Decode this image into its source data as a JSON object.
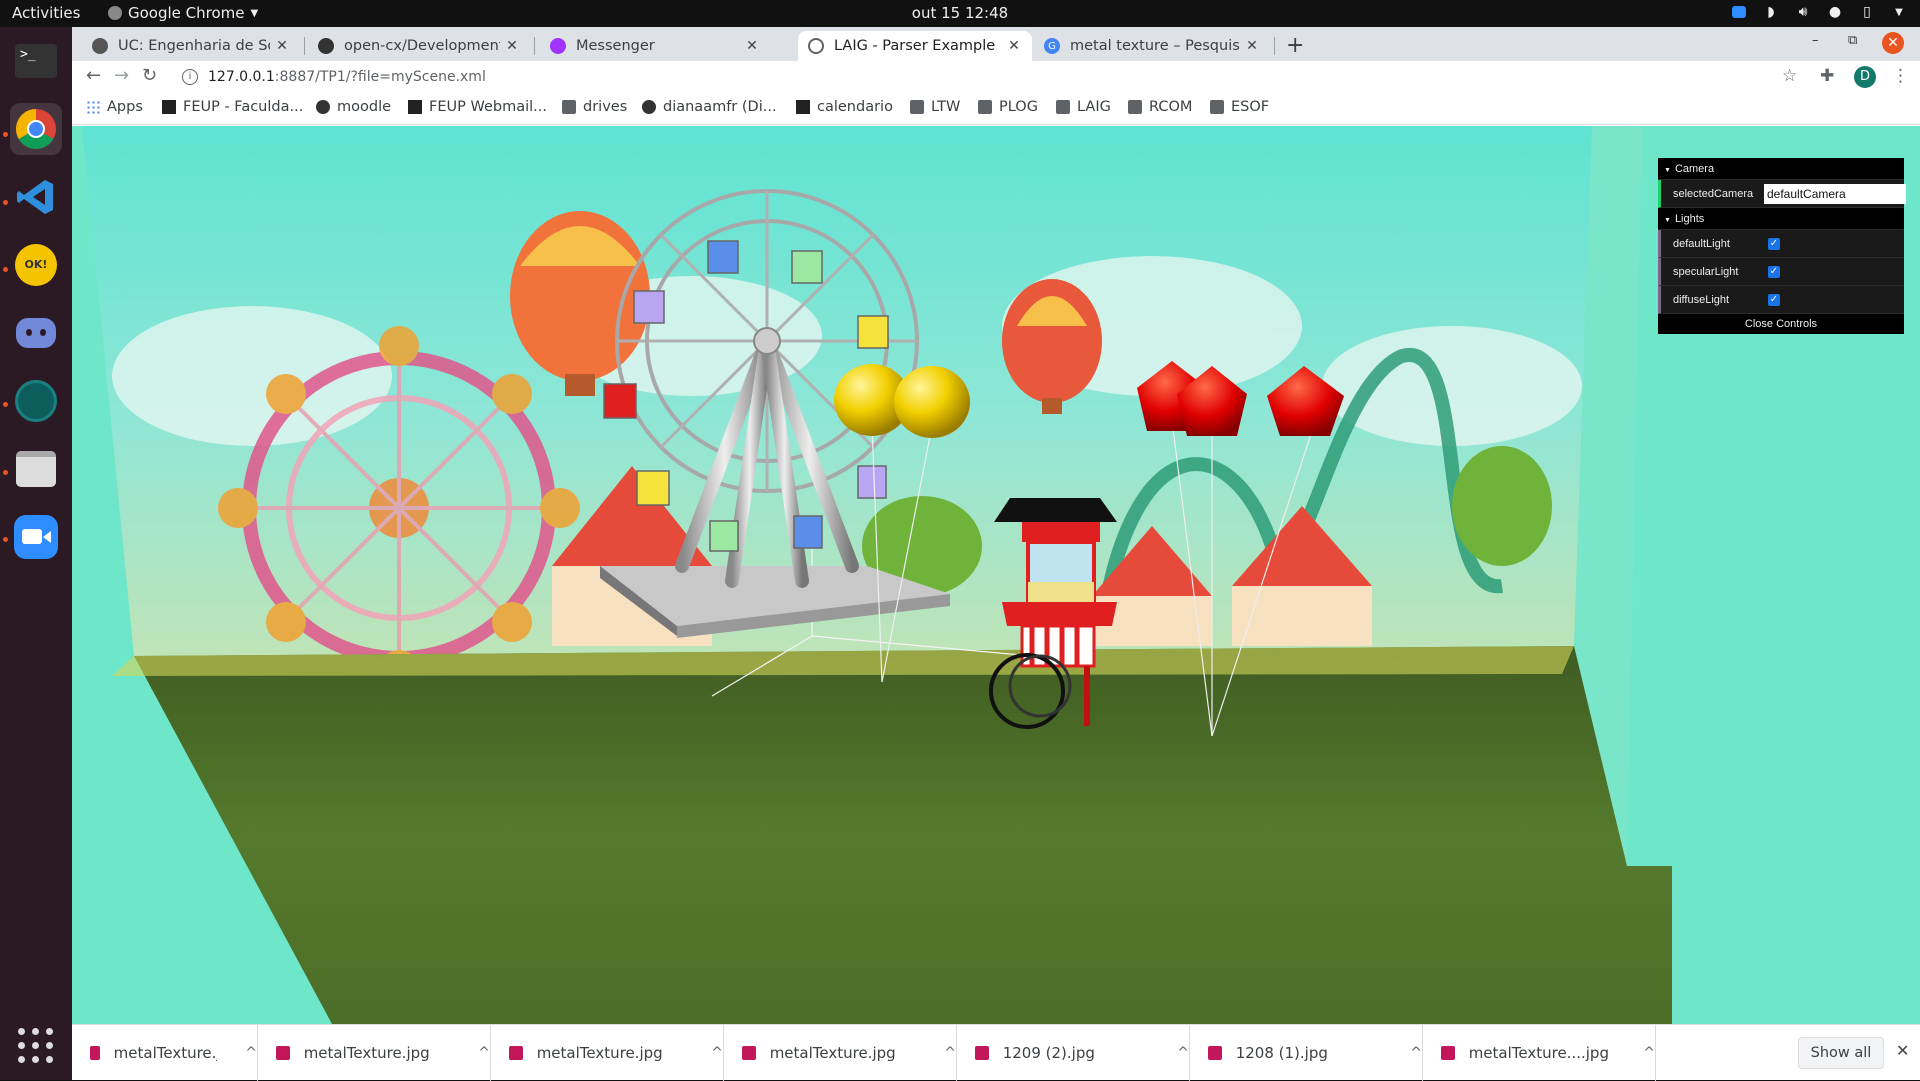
{
  "topbar": {
    "activities": "Activities",
    "app_name": "Google Chrome",
    "clock": "out 15  12:48"
  },
  "dock": {
    "items": [
      "terminal-icon",
      "chrome-icon",
      "vscode-icon",
      "toki-icon",
      "discord-icon",
      "gitkraken-icon",
      "files-icon",
      "zoom-icon"
    ]
  },
  "tabs": [
    {
      "title": "UC: Engenharia de Softwa",
      "favicon_color": "#555555"
    },
    {
      "title": "open-cx/Development-Re",
      "favicon_color": "#333333"
    },
    {
      "title": "Messenger",
      "favicon_color": "#a033ff"
    },
    {
      "title": "LAIG - Parser Example",
      "favicon_color": "#5f6368",
      "active": true
    },
    {
      "title": "metal texture – Pesquisa",
      "favicon_color": "#4285f4"
    }
  ],
  "address": {
    "host": "127.0.0.1",
    "path": ":8887/TP1/?file=myScene.xml"
  },
  "profile_initial": "D",
  "bookmarks": [
    {
      "label": "Apps",
      "icon": "apps"
    },
    {
      "label": "FEUP - Faculda...",
      "icon": "square"
    },
    {
      "label": "moodle",
      "icon": "circle"
    },
    {
      "label": "FEUP Webmail...",
      "icon": "square"
    },
    {
      "label": "drives",
      "icon": "folder"
    },
    {
      "label": "dianaamfr (Di...",
      "icon": "circle"
    },
    {
      "label": "calendario",
      "icon": "square"
    },
    {
      "label": "LTW",
      "icon": "folder"
    },
    {
      "label": "PLOG",
      "icon": "folder"
    },
    {
      "label": "LAIG",
      "icon": "folder"
    },
    {
      "label": "RCOM",
      "icon": "folder"
    },
    {
      "label": "ESOF",
      "icon": "folder"
    }
  ],
  "gui": {
    "camera_folder": "Camera",
    "selected_camera_label": "selectedCamera",
    "selected_camera_value": "defaultCamera",
    "lights_folder": "Lights",
    "lights": [
      {
        "label": "defaultLight",
        "checked": true
      },
      {
        "label": "specularLight",
        "checked": true
      },
      {
        "label": "diffuseLight",
        "checked": true
      }
    ],
    "close_label": "Close Controls"
  },
  "downloads": {
    "items": [
      "metalTexture.jpg",
      "metalTexture.jpg",
      "metalTexture.jpg",
      "metalTexture.jpg",
      "1209 (2).jpg",
      "1208 (1).jpg",
      "metalTexture....jpg"
    ],
    "show_all": "Show all"
  },
  "colors": {
    "ubuntu_orange": "#e95420",
    "dock_bg": "#2b1a24",
    "sky": "#6ee6c9",
    "grass": "#4f6e2a"
  }
}
